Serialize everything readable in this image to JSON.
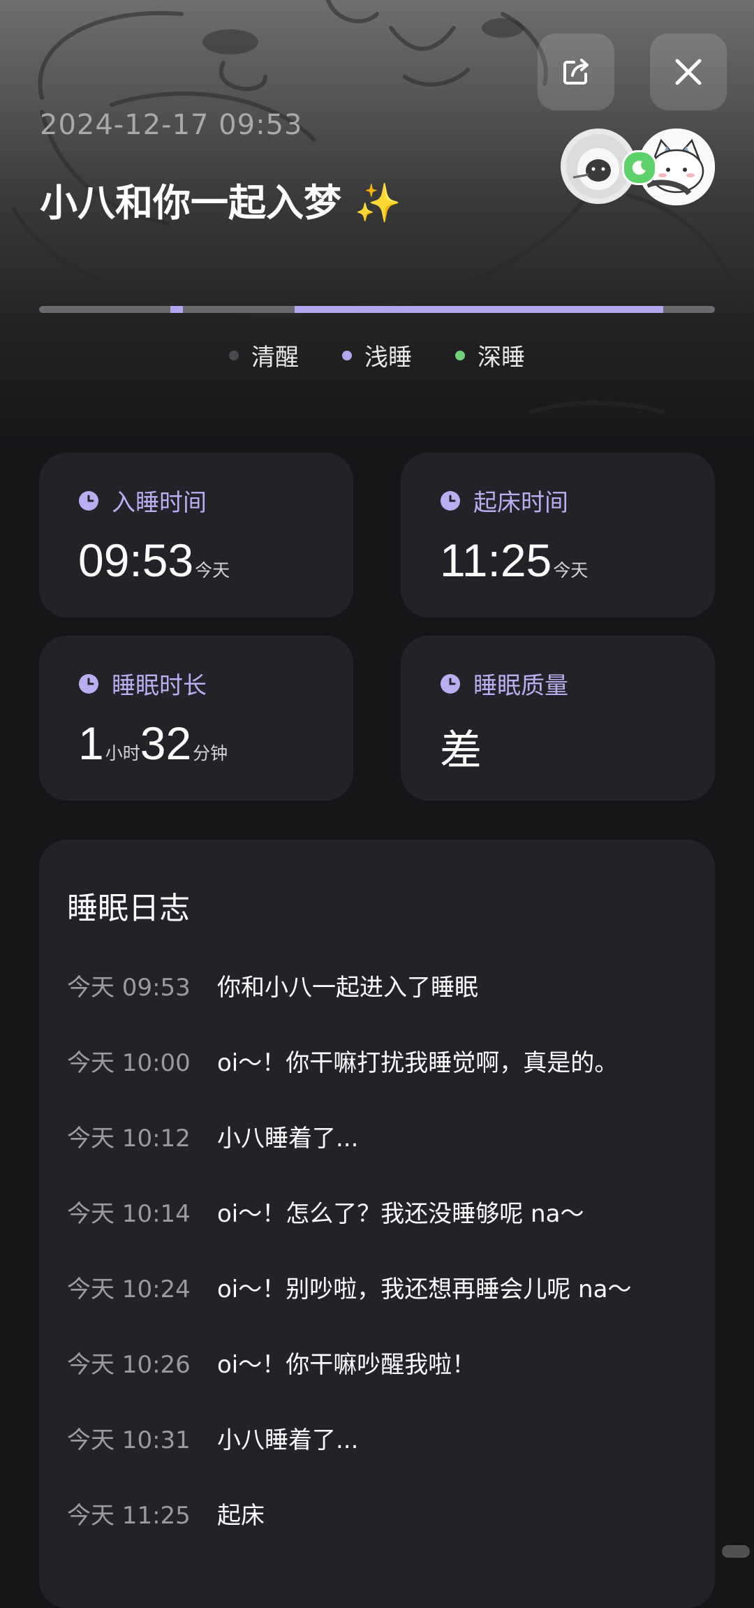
{
  "header": {
    "date": "2024-12-17 09:53",
    "title": "小八和你一起入梦 ✨",
    "share_icon": "share-icon",
    "close_icon": "close-icon"
  },
  "sleep_bar": {
    "segments": [
      {
        "stage": "浅睡",
        "start": 0.194,
        "end": 0.213
      },
      {
        "stage": "浅睡",
        "start": 0.378,
        "end": 0.924
      }
    ]
  },
  "legend": [
    {
      "label": "清醒",
      "color": "#4a4a4e"
    },
    {
      "label": "浅睡",
      "color": "#b4a6ec"
    },
    {
      "label": "深睡",
      "color": "#6fd37a"
    }
  ],
  "cards": {
    "sleep_time": {
      "label": "入睡时间",
      "value": "09:53",
      "suffix": "今天"
    },
    "wake_time": {
      "label": "起床时间",
      "value": "11:25",
      "suffix": "今天"
    },
    "duration": {
      "label": "睡眠时长",
      "hours": "1",
      "hours_unit": "小时",
      "minutes": "32",
      "minutes_unit": "分钟"
    },
    "quality": {
      "label": "睡眠质量",
      "value": "差"
    }
  },
  "log": {
    "title": "睡眠日志",
    "entries": [
      {
        "time": "今天 09:53",
        "text": "你和小八一起进入了睡眠"
      },
      {
        "time": "今天 10:00",
        "text": "oi～！你干嘛打扰我睡觉啊，真是的。"
      },
      {
        "time": "今天 10:12",
        "text": "小八睡着了..."
      },
      {
        "time": "今天 10:14",
        "text": "oi～！怎么了？我还没睡够呢 na～"
      },
      {
        "time": "今天 10:24",
        "text": "oi～！别吵啦，我还想再睡会儿呢 na～"
      },
      {
        "time": "今天 10:26",
        "text": "oi～！你干嘛吵醒我啦！"
      },
      {
        "time": "今天 10:31",
        "text": "小八睡着了..."
      },
      {
        "time": "今天 11:25",
        "text": "起床"
      }
    ]
  },
  "colors": {
    "accent": "#b9aef0",
    "card_bg": "#232228",
    "page_bg": "#161619"
  }
}
